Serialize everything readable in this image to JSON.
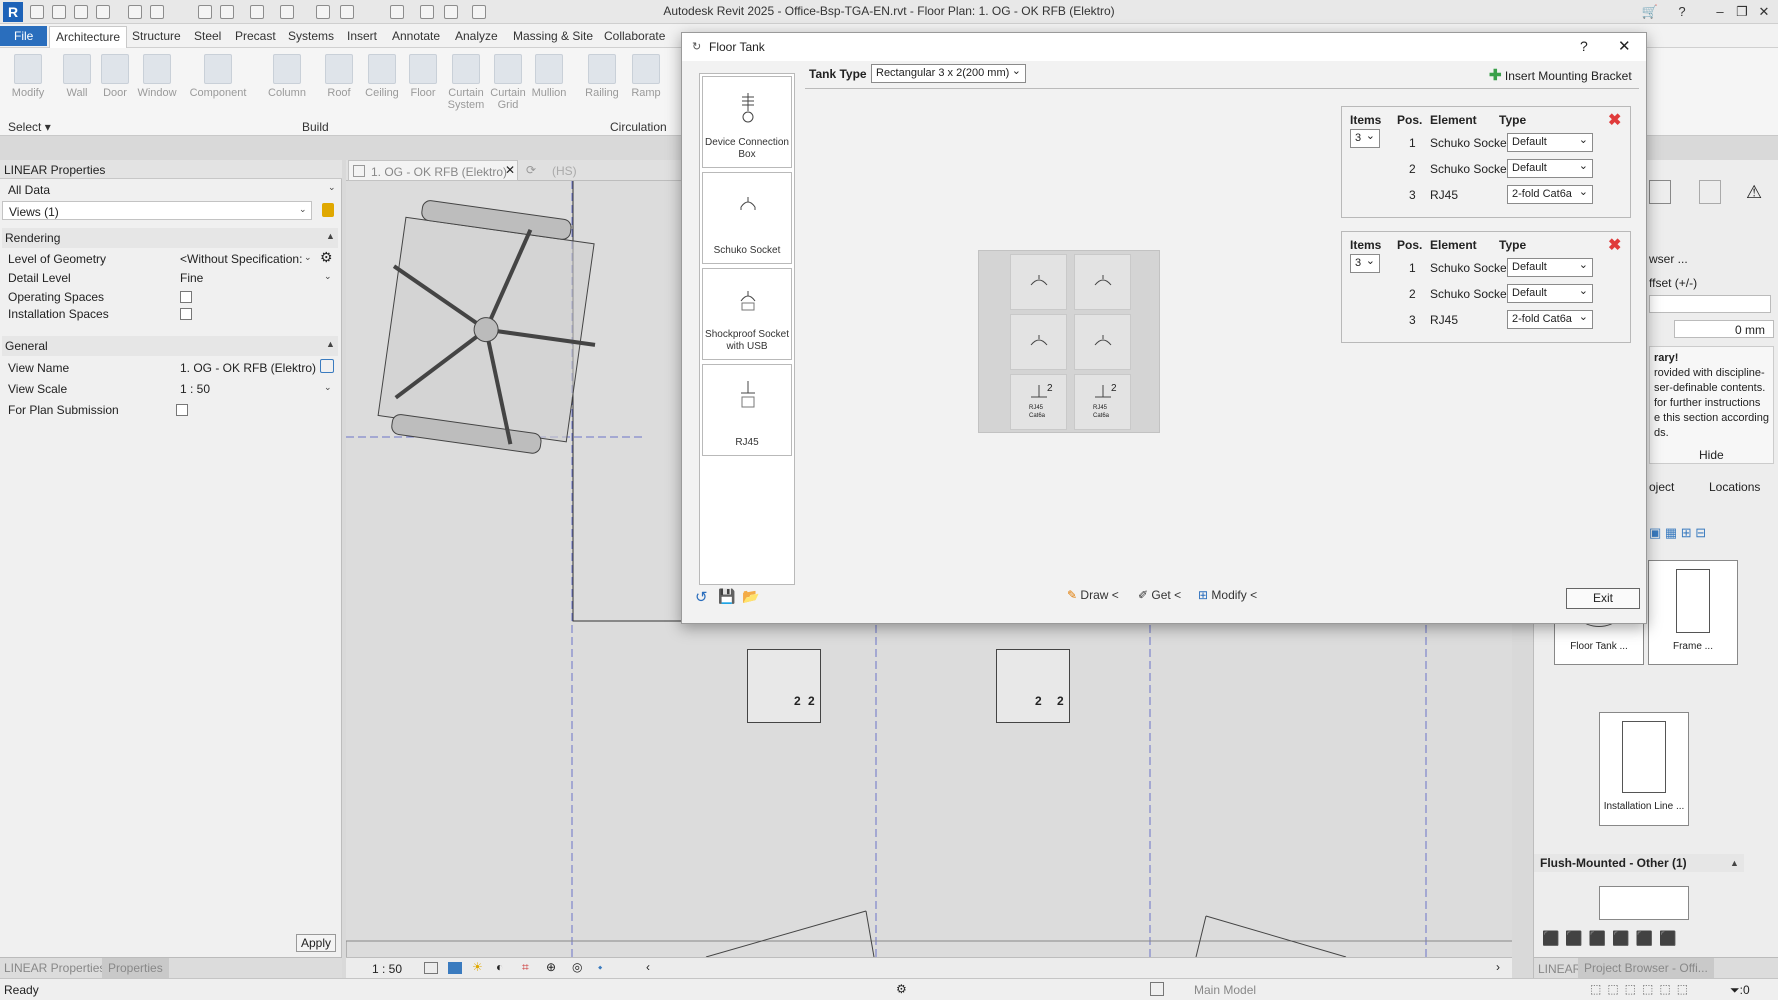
{
  "window": {
    "title": "Autodesk Revit 2025 - Office-Bsp-TGA-EN.rvt - Floor Plan: 1. OG - OK RFB (Elektro)",
    "logo": "R"
  },
  "ribbon": {
    "tabs": [
      "File",
      "Architecture",
      "Structure",
      "Steel",
      "Precast",
      "Systems",
      "Insert",
      "Annotate",
      "Analyze",
      "Massing & Site",
      "Collaborate"
    ],
    "buttons": [
      "Modify",
      "Wall",
      "Door",
      "Window",
      "Component",
      "Column",
      "Roof",
      "Ceiling",
      "Floor",
      "Curtain System",
      "Curtain Grid",
      "Mullion",
      "Railing",
      "Ramp"
    ],
    "groups": {
      "select": "Select",
      "build": "Build",
      "circulation": "Circulation"
    }
  },
  "properties": {
    "title": "LINEAR Properties",
    "filter": "All Data",
    "views": "Views (1)",
    "sections": {
      "rendering": "Rendering",
      "general": "General"
    },
    "rows": {
      "level_of_geometry": {
        "k": "Level of Geometry",
        "v": "<Without Specification:"
      },
      "detail_level": {
        "k": "Detail Level",
        "v": "Fine"
      },
      "operating_spaces": {
        "k": "Operating Spaces"
      },
      "installation_spaces": {
        "k": "Installation Spaces"
      },
      "view_name": {
        "k": "View Name",
        "v": "1. OG - OK RFB (Elektro)"
      },
      "view_scale": {
        "k": "View Scale",
        "v": "1 : 50"
      },
      "plan_submission": {
        "k": "For Plan Submission"
      }
    },
    "apply": "Apply",
    "tabs": [
      "LINEAR Properties",
      "Properties"
    ]
  },
  "view": {
    "tab": "1. OG - OK RFB (Elektro)",
    "tab2": "(HS)",
    "scale": "1 : 50"
  },
  "dialog": {
    "title": "Floor Tank",
    "help": "?",
    "tank_type_label": "Tank Type",
    "tank_type_value": "Rectangular 3 x 2(200 mm)",
    "insert_bracket": "Insert Mounting Bracket",
    "library": [
      "Device Connection Box",
      "Schuko Socket",
      "Shockproof Socket with USB",
      "RJ45"
    ],
    "headers": {
      "items": "Items",
      "pos": "Pos.",
      "element": "Element",
      "type": "Type"
    },
    "configs": [
      {
        "items": "3",
        "rows": [
          {
            "pos": "1",
            "element": "Schuko Socket",
            "type": "Default"
          },
          {
            "pos": "2",
            "element": "Schuko Socket",
            "type": "Default"
          },
          {
            "pos": "3",
            "element": "RJ45",
            "type": "2-fold Cat6a"
          }
        ]
      },
      {
        "items": "3",
        "rows": [
          {
            "pos": "1",
            "element": "Schuko Socket",
            "type": "Default"
          },
          {
            "pos": "2",
            "element": "Schuko Socket",
            "type": "Default"
          },
          {
            "pos": "3",
            "element": "RJ45",
            "type": "2-fold Cat6a"
          }
        ]
      }
    ],
    "bottom": {
      "draw": "Draw <",
      "get": "Get <",
      "modify": "Modify <",
      "exit": "Exit"
    },
    "preview_labels": {
      "two": "2",
      "rj45": "RJ45",
      "cat": "Cat6a"
    }
  },
  "canvas": {
    "tank_number": "2"
  },
  "right_panel": {
    "lines": [
      "wser ...",
      "ffset (+/-)",
      "0 mm",
      "rary!",
      "rovided with discipline-",
      "ser-definable contents.",
      "for further instructions",
      "e this section according",
      "ds."
    ],
    "hide": "Hide",
    "tabs": [
      "oject",
      "Locations"
    ],
    "cards": [
      "Floor Tank ...",
      "Frame ...",
      "Installation Line ..."
    ],
    "section": "Flush-Mounted - Other (1)",
    "bottom_tabs": [
      "LINEAR",
      "Project Browser - Offi..."
    ]
  },
  "status": {
    "ready": "Ready",
    "model": "Main Model",
    "filter": ":0"
  },
  "colors": {
    "accent": "#2a6ebd",
    "delete": "#e03b3b",
    "add": "#3aa04a"
  }
}
